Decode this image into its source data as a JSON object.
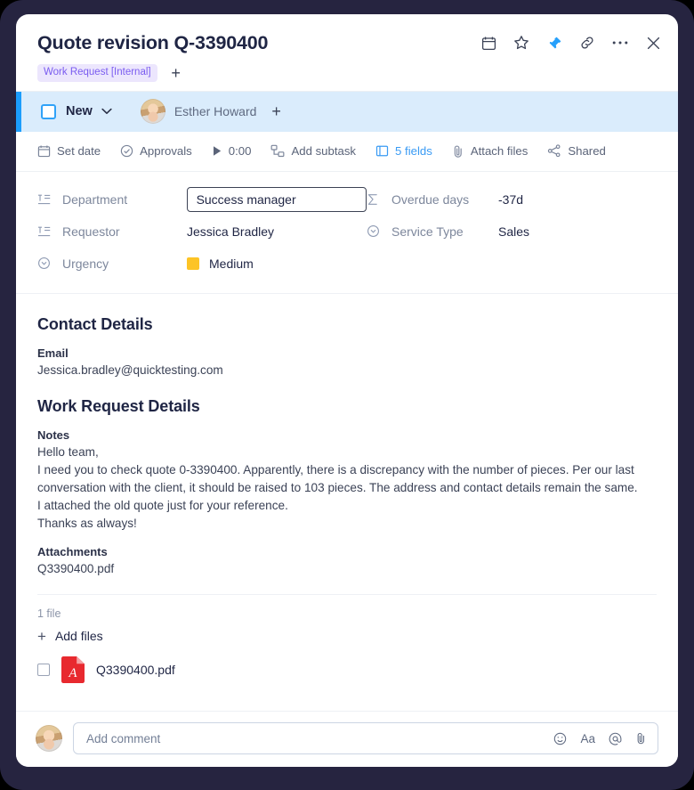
{
  "header": {
    "title": "Quote revision Q-3390400",
    "tag": "Work Request [Internal]",
    "add_tag_label": "+",
    "icons": [
      {
        "name": "calendar-icon",
        "label": "Calendar"
      },
      {
        "name": "star-icon",
        "label": "Favorite"
      },
      {
        "name": "pin-icon",
        "label": "Pin",
        "color": "#1b9dfc",
        "active": true
      },
      {
        "name": "link-icon",
        "label": "Copy link"
      },
      {
        "name": "more-icon",
        "label": "More"
      },
      {
        "name": "close-icon",
        "label": "Close"
      }
    ]
  },
  "status_bar": {
    "accent_color": "#1b9dfc",
    "background": "#daecfc",
    "status_label": "New",
    "assignee_name": "Esther Howard",
    "add_assignee_label": "+"
  },
  "action_bar": {
    "items": [
      {
        "label": "Set date",
        "icon": "calendar-icon",
        "highlight": false
      },
      {
        "label": "Approvals",
        "icon": "check-circle-icon",
        "highlight": false
      },
      {
        "label": "0:00",
        "icon": "play-icon",
        "highlight": false
      },
      {
        "label": "Add subtask",
        "icon": "subtask-icon",
        "highlight": false
      },
      {
        "label": "5 fields",
        "icon": "fields-icon",
        "highlight": true
      },
      {
        "label": "Attach files",
        "icon": "paperclip-icon",
        "highlight": false
      },
      {
        "label": "Shared",
        "icon": "share-icon",
        "highlight": false
      }
    ]
  },
  "fields": {
    "left": [
      {
        "label": "Department",
        "value": "Success manager",
        "icon": "text-field-icon",
        "boxed": true
      },
      {
        "label": "Requestor",
        "value": "Jessica Bradley",
        "icon": "text-field-icon",
        "boxed": false
      },
      {
        "label": "Urgency",
        "value": "Medium",
        "icon": "dropdown-field-icon",
        "boxed": false,
        "swatch": "#fdc425"
      }
    ],
    "right": [
      {
        "label": "Overdue days",
        "value": "-37d",
        "icon": "formula-icon"
      },
      {
        "label": "Service Type",
        "value": "Sales",
        "icon": "dropdown-field-icon"
      }
    ]
  },
  "content": {
    "contact_heading": "Contact Details",
    "email_label": "Email",
    "email_value": "Jessica.bradley@quicktesting.com",
    "work_heading": "Work Request Details",
    "notes_label": "Notes",
    "notes_lines": [
      "Hello team,",
      "I need you to check quote 0-3390400. Apparently, there is a discrepancy with the number of pieces. Per our last conversation with the client, it should be raised to 103 pieces. The address and contact details remain the same.",
      "I attached the old quote just for your reference.",
      "Thanks as always!"
    ],
    "attachments_label": "Attachments",
    "attachments_value": "Q3390400.pdf"
  },
  "files": {
    "count_label": "1 file",
    "add_files_label": "Add files",
    "add_files_plus": "+",
    "items": [
      {
        "name": "Q3390400.pdf",
        "type": "pdf"
      }
    ]
  },
  "comment": {
    "placeholder": "Add comment",
    "value": "",
    "icons": [
      {
        "name": "emoji-icon",
        "label": "Emoji"
      },
      {
        "name": "text-format-icon",
        "label": "Aa"
      },
      {
        "name": "mention-icon",
        "label": "Mention"
      },
      {
        "name": "attach-icon",
        "label": "Attach"
      }
    ]
  }
}
